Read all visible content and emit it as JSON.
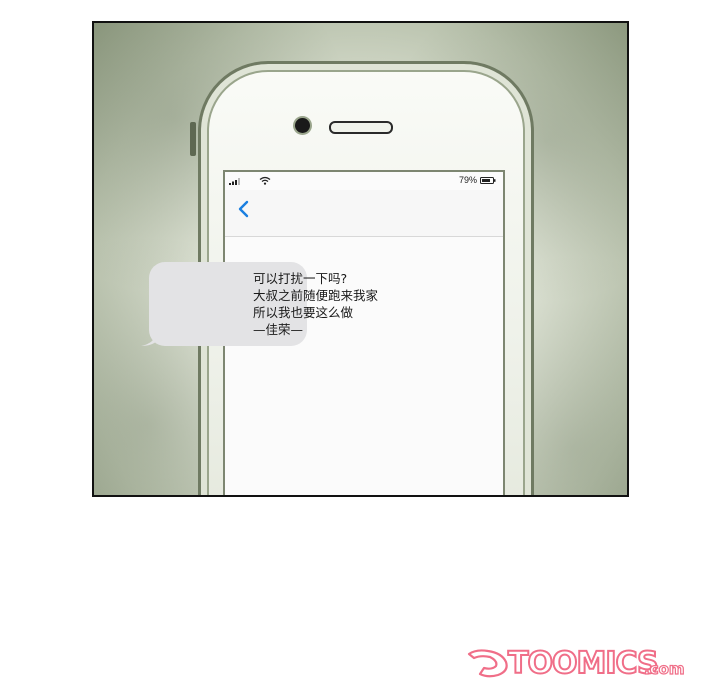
{
  "status_bar": {
    "battery_percent": "79%",
    "icons": [
      "signal-icon",
      "wifi-icon",
      "battery-icon"
    ]
  },
  "nav": {
    "back_icon": "chevron-left-icon",
    "accent_color": "#1a7fe0"
  },
  "message": {
    "lines": [
      "可以打扰一下吗?",
      "大叔之前随便跑来我家",
      "所以我也要这么做",
      "—佳荣—"
    ],
    "bubble_color": "#e3e3e5"
  },
  "watermark": {
    "brand": "TOOMICS",
    "suffix": ".com",
    "color": "#f06e88"
  }
}
